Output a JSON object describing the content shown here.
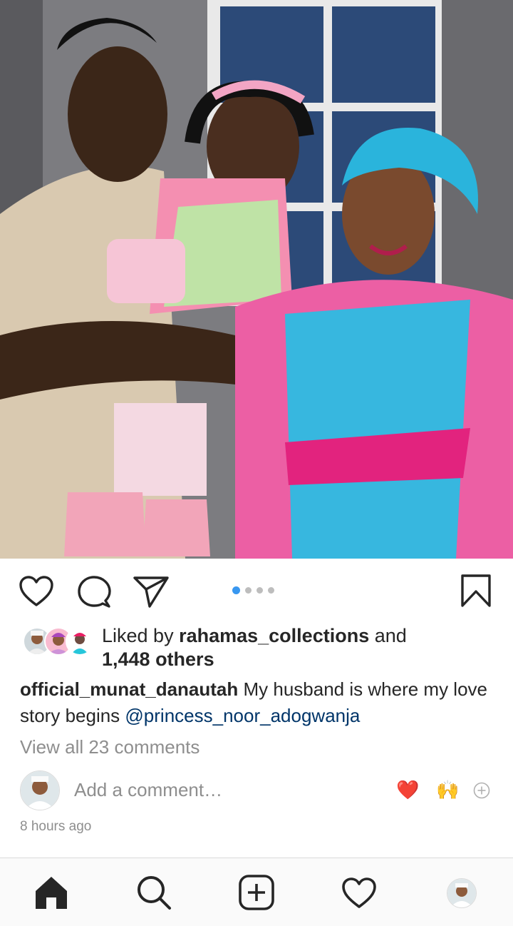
{
  "post": {
    "image_description_icon": "family-photo",
    "carousel": {
      "count": 4,
      "active_index": 0
    },
    "likes": {
      "prefix": "Liked by ",
      "liked_by_user": "rahamas_collections",
      "conjunction": " and",
      "others": "1,448 others"
    },
    "caption": {
      "author": "official_munat_danautah",
      "text": " My husband is where my love story begins ",
      "mention": "@princess_noor_adogwanja"
    },
    "view_comments": "View all 23 comments",
    "add_comment_placeholder": "Add a comment…",
    "quick_reactions": [
      "❤️",
      "🙌"
    ],
    "timestamp": "8 hours ago"
  },
  "icons": {
    "like": "heart-icon",
    "comment": "comment-icon",
    "share": "send-icon",
    "save": "bookmark-icon",
    "add_reaction": "plus-circle-icon",
    "nav_home": "home-icon",
    "nav_search": "search-icon",
    "nav_new": "add-post-icon",
    "nav_activity": "heart-icon",
    "nav_profile": "profile-avatar"
  },
  "colors": {
    "accent_blue": "#3897f0",
    "mention_blue": "#003569",
    "muted_text": "#8e8e8e",
    "text": "#262626",
    "reaction_red": "#ed4956"
  }
}
